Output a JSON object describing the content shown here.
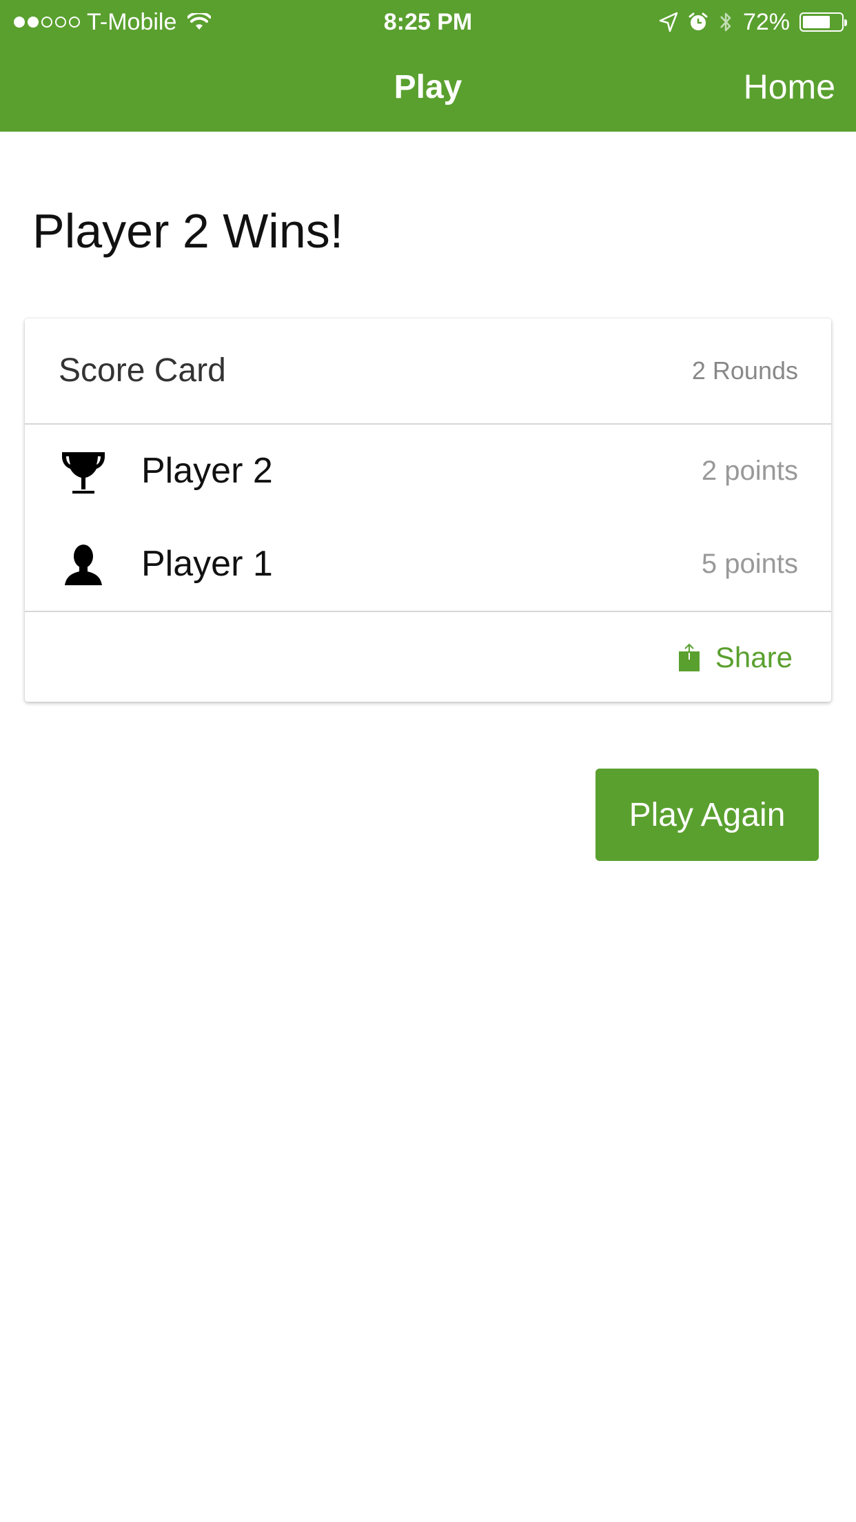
{
  "colors": {
    "accent": "#5aa02f",
    "text": "#111111",
    "muted": "#999999"
  },
  "status_bar": {
    "signal_strength": "2 of 5",
    "carrier": "T-Mobile",
    "time": "8:25 PM",
    "battery_percent": "72%",
    "battery_level": 0.72,
    "icons": [
      "wifi-icon",
      "location-arrow-icon",
      "alarm-icon",
      "bluetooth-icon",
      "battery-icon"
    ]
  },
  "nav": {
    "title": "Play",
    "home_label": "Home"
  },
  "result": {
    "headline": "Player 2 Wins!"
  },
  "score_card": {
    "title": "Score Card",
    "rounds": "2 Rounds",
    "players": [
      {
        "icon": "trophy-icon",
        "name": "Player 2",
        "points": "2 points"
      },
      {
        "icon": "person-icon",
        "name": "Player 1",
        "points": "5 points"
      }
    ],
    "share_label": "Share"
  },
  "actions": {
    "play_again_label": "Play Again"
  }
}
